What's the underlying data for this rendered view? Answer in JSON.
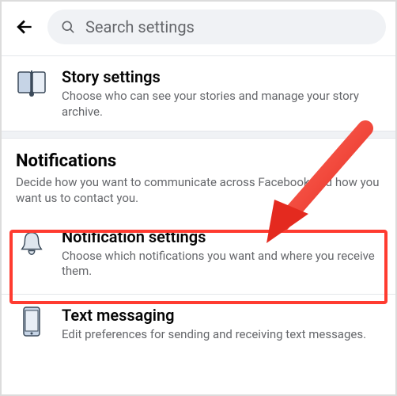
{
  "search": {
    "placeholder": "Search settings"
  },
  "story": {
    "title": "Story settings",
    "sub": "Choose who can see your stories and manage your story archive."
  },
  "notifications_section": {
    "heading": "Notifications",
    "description": "Decide how you want to communicate across Facebook and how you want us to contact you."
  },
  "notification_settings": {
    "title": "Notification settings",
    "sub": "Choose which notifications you want and where you receive them."
  },
  "text_messaging": {
    "title": "Text messaging",
    "sub": "Edit preferences for sending and receiving text messages."
  }
}
